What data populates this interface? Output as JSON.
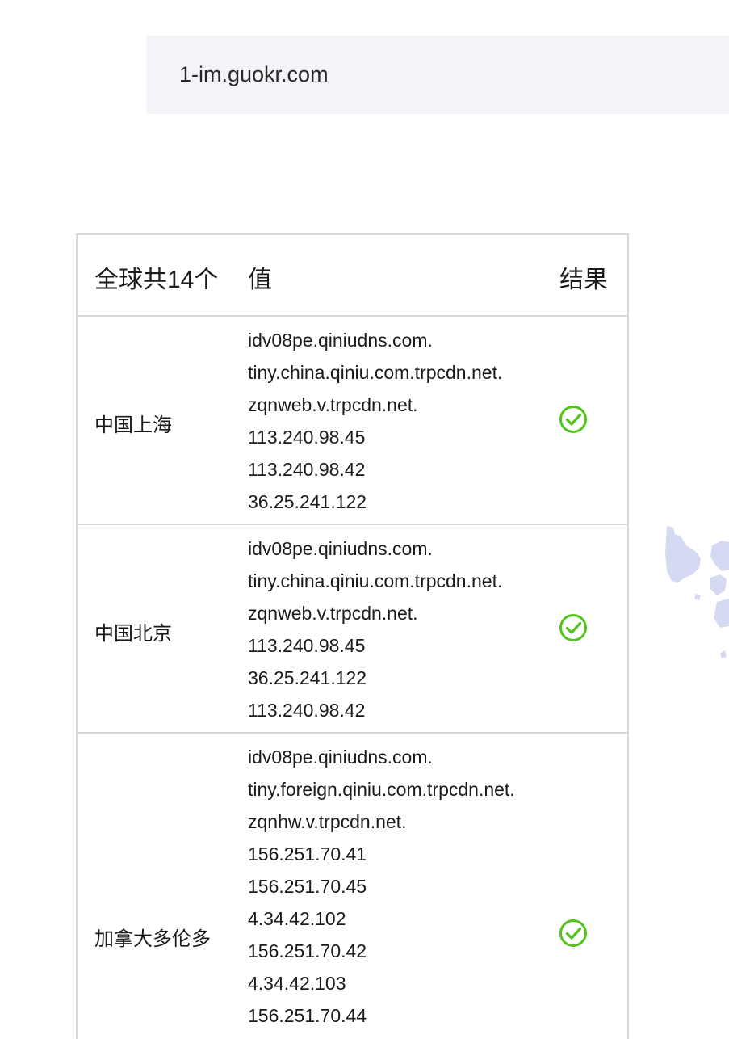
{
  "domain": "1-im.guokr.com",
  "table": {
    "headers": {
      "location": "全球共14个",
      "value": "值",
      "result": "结果"
    },
    "rows": [
      {
        "location": "中国上海",
        "values": [
          "idv08pe.qiniudns.com.",
          "tiny.china.qiniu.com.trpcdn.net.",
          "zqnweb.v.trpcdn.net.",
          "113.240.98.45",
          "113.240.98.42",
          "36.25.241.122"
        ],
        "status_icon": "check-circle-icon"
      },
      {
        "location": "中国北京",
        "values": [
          "idv08pe.qiniudns.com.",
          "tiny.china.qiniu.com.trpcdn.net.",
          "zqnweb.v.trpcdn.net.",
          "113.240.98.45",
          "36.25.241.122",
          "113.240.98.42"
        ],
        "status_icon": "check-circle-icon"
      },
      {
        "location": "加拿大多伦多",
        "values": [
          "idv08pe.qiniudns.com.",
          "tiny.foreign.qiniu.com.trpcdn.net.",
          "zqnhw.v.trpcdn.net.",
          "156.251.70.41",
          "156.251.70.45",
          "4.34.42.102",
          "156.251.70.42",
          "4.34.42.103",
          "156.251.70.44"
        ],
        "status_icon": "check-circle-icon"
      }
    ]
  },
  "colors": {
    "success": "#52c41a",
    "border": "#d9d9d9",
    "domain_bg": "#f3f4f8",
    "map": "#d5d9f2"
  }
}
